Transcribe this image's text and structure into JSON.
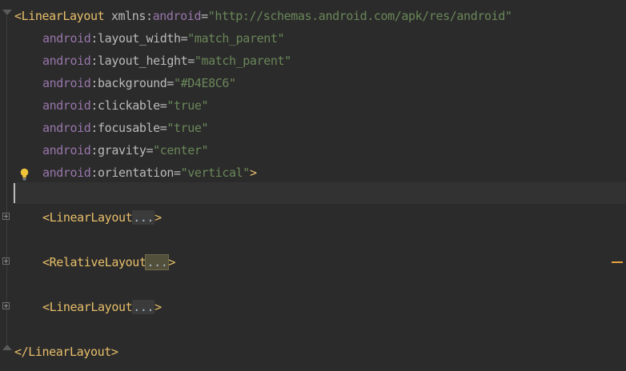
{
  "code": {
    "line1": {
      "open": "<",
      "tag": "LinearLayout",
      "space": " ",
      "xmlns": "xmlns:",
      "ns": "android",
      "eq": "=",
      "value": "\"http://schemas.android.com/apk/res/android\""
    },
    "attrs": [
      {
        "ns": "android",
        "name": ":layout_width=",
        "value": "\"match_parent\""
      },
      {
        "ns": "android",
        "name": ":layout_height=",
        "value": "\"match_parent\""
      },
      {
        "ns": "android",
        "name": ":background=",
        "value": "\"#D4E8C6\""
      },
      {
        "ns": "android",
        "name": ":clickable=",
        "value": "\"true\""
      },
      {
        "ns": "android",
        "name": ":focusable=",
        "value": "\"true\""
      },
      {
        "ns": "android",
        "name": ":gravity=",
        "value": "\"center\""
      },
      {
        "ns": "android",
        "name": ":orientation=",
        "value": "\"vertical\"",
        "close": ">"
      }
    ],
    "children": [
      {
        "open": "<",
        "tag": "LinearLayout",
        "folded": "...",
        "close": ">"
      },
      {
        "open": "<",
        "tag": "RelativeLayout",
        "folded": "...",
        "close": ">"
      },
      {
        "open": "<",
        "tag": "LinearLayout",
        "folded": "...",
        "close": ">"
      }
    ],
    "closing": "</LinearLayout>"
  },
  "colors": {
    "background": "#2b2b2b",
    "tag": "#e8bf6a",
    "namespace": "#9876aa",
    "string": "#6a8759",
    "text": "#a9b7c6",
    "warning": "#e8a33d"
  },
  "icons": {
    "intention": "lightbulb-icon",
    "fold": "fold-expand-icon"
  }
}
